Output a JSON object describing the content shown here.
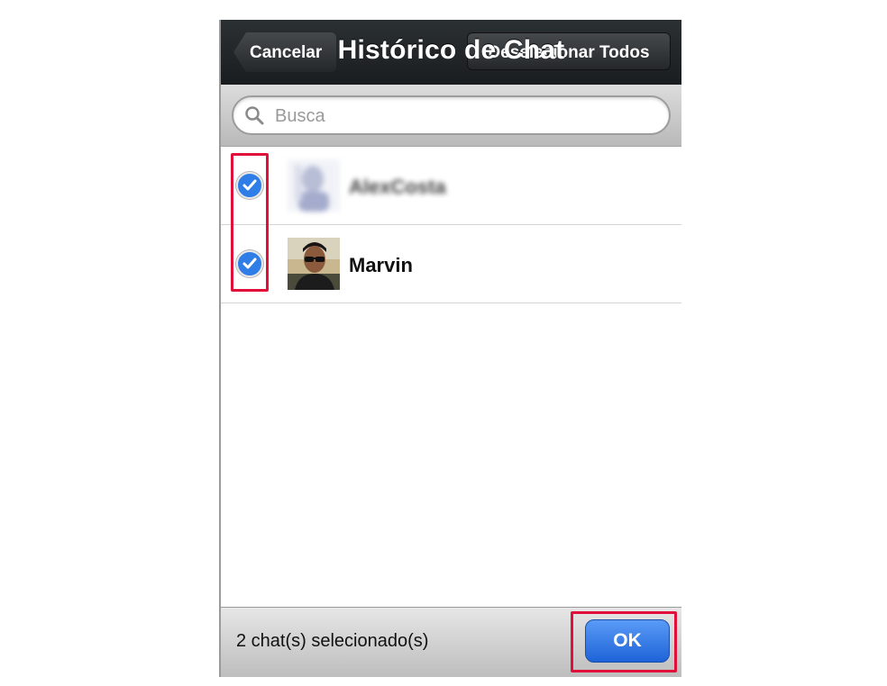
{
  "navbar": {
    "title": "Histórico de Chat",
    "back_label": "Cancelar",
    "right_label": "Deselecionar Todos"
  },
  "search": {
    "placeholder": "Busca",
    "icon": "search-icon"
  },
  "contacts": [
    {
      "name": "AlexCosta",
      "selected": true,
      "blurred": true
    },
    {
      "name": "Marvin",
      "selected": true,
      "blurred": false
    }
  ],
  "toolbar": {
    "count_label": "2 chat(s) selecionado(s)",
    "ok_label": "OK"
  },
  "colors": {
    "accent": "#2f7ee8",
    "highlight": "#e0103a",
    "navbar": "#1f2325"
  }
}
